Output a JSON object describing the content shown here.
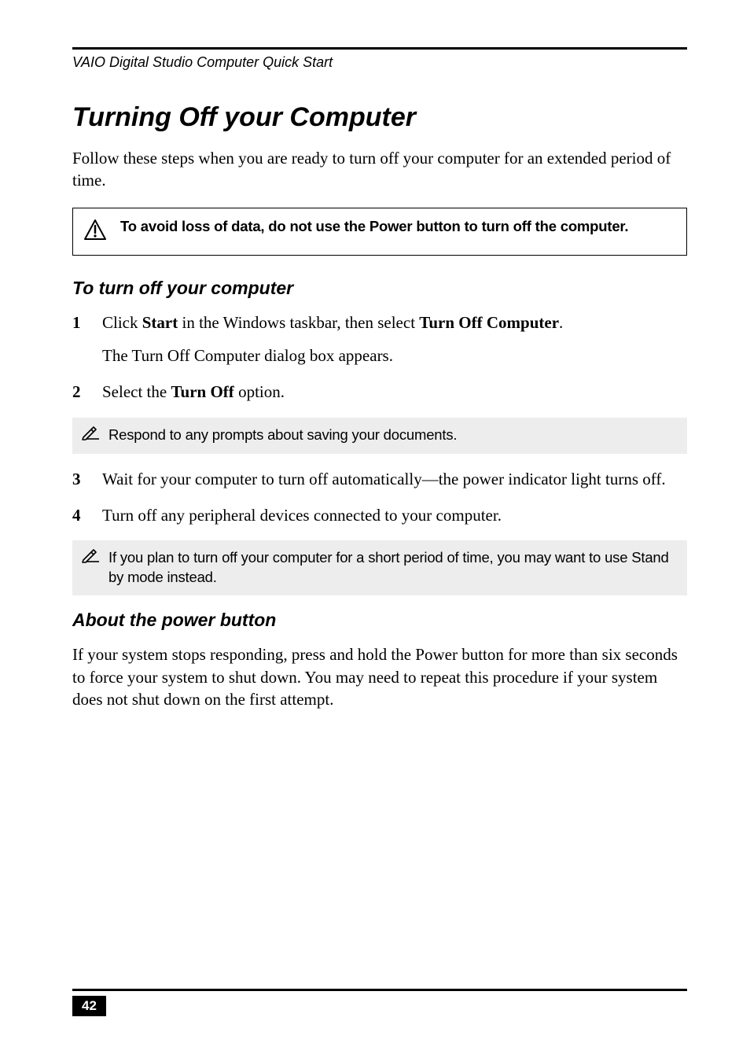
{
  "running_head": "VAIO Digital Studio Computer Quick Start",
  "title": "Turning Off your Computer",
  "intro": "Follow these steps when you are ready to turn off your computer for an extended period of time.",
  "warning": "To avoid loss of data, do not use the Power button to turn off the computer.",
  "sub1": "To turn off your computer",
  "step1_pre": "Click ",
  "step1_bold1": "Start",
  "step1_mid": " in the Windows taskbar, then select ",
  "step1_bold2": "Turn Off Computer",
  "step1_post": ".",
  "step1_sub": "The Turn Off Computer dialog box appears.",
  "step2_pre": "Select the ",
  "step2_bold": "Turn Off",
  "step2_post": " option.",
  "note1": "Respond to any prompts about saving your documents.",
  "step3": "Wait for your computer to turn off automatically—the power indicator light turns off.",
  "step4": "Turn off any peripheral devices connected to your computer.",
  "note2": "If you plan to turn off your computer for a short period of time, you may want to use Stand by mode instead.",
  "sub2": "About the power button",
  "about_body": "If your system stops responding, press and hold the Power button for more than six seconds to force your system to shut down. You may need to repeat this procedure if your system does not shut down on the first attempt.",
  "page_number": "42"
}
